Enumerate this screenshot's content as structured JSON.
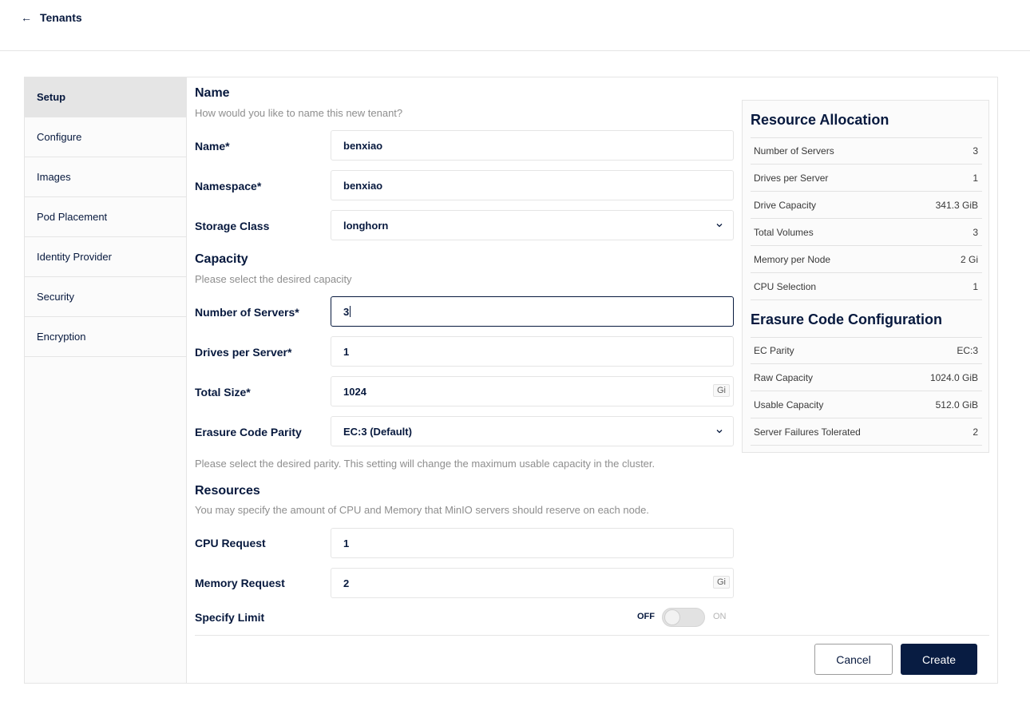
{
  "header": {
    "back_label": "Tenants"
  },
  "sidebar": {
    "items": [
      {
        "label": "Setup"
      },
      {
        "label": "Configure"
      },
      {
        "label": "Images"
      },
      {
        "label": "Pod Placement"
      },
      {
        "label": "Identity Provider"
      },
      {
        "label": "Security"
      },
      {
        "label": "Encryption"
      }
    ]
  },
  "name_section": {
    "title": "Name",
    "desc": "How would you like to name this new tenant?",
    "name_label": "Name*",
    "name_value": "benxiao",
    "namespace_label": "Namespace*",
    "namespace_value": "benxiao",
    "storage_class_label": "Storage Class",
    "storage_class_value": "longhorn"
  },
  "capacity_section": {
    "title": "Capacity",
    "desc": "Please select the desired capacity",
    "servers_label": "Number of Servers*",
    "servers_value": "3",
    "drives_label": "Drives per Server*",
    "drives_value": "1",
    "total_size_label": "Total Size*",
    "total_size_value": "1024",
    "total_size_unit": "Gi",
    "ec_parity_label": "Erasure Code Parity",
    "ec_parity_value": "EC:3 (Default)",
    "ec_parity_help": "Please select the desired parity. This setting will change the maximum usable capacity in the cluster."
  },
  "resources_section": {
    "title": "Resources",
    "desc": "You may specify the amount of CPU and Memory that MinIO servers should reserve on each node.",
    "cpu_label": "CPU Request",
    "cpu_value": "1",
    "memory_label": "Memory Request",
    "memory_value": "2",
    "memory_unit": "Gi",
    "limit_label": "Specify Limit",
    "toggle_off": "OFF",
    "toggle_on": "ON"
  },
  "buttons": {
    "cancel": "Cancel",
    "create": "Create"
  },
  "resource_allocation": {
    "title": "Resource Allocation",
    "rows": [
      {
        "label": "Number of Servers",
        "value": "3"
      },
      {
        "label": "Drives per Server",
        "value": "1"
      },
      {
        "label": "Drive Capacity",
        "value": "341.3 GiB"
      },
      {
        "label": "Total Volumes",
        "value": "3"
      },
      {
        "label": "Memory per Node",
        "value": "2 Gi"
      },
      {
        "label": "CPU Selection",
        "value": "1"
      }
    ]
  },
  "erasure_config": {
    "title": "Erasure Code Configuration",
    "rows": [
      {
        "label": "EC Parity",
        "value": "EC:3"
      },
      {
        "label": "Raw Capacity",
        "value": "1024.0 GiB"
      },
      {
        "label": "Usable Capacity",
        "value": "512.0 GiB"
      },
      {
        "label": "Server Failures Tolerated",
        "value": "2"
      }
    ]
  }
}
